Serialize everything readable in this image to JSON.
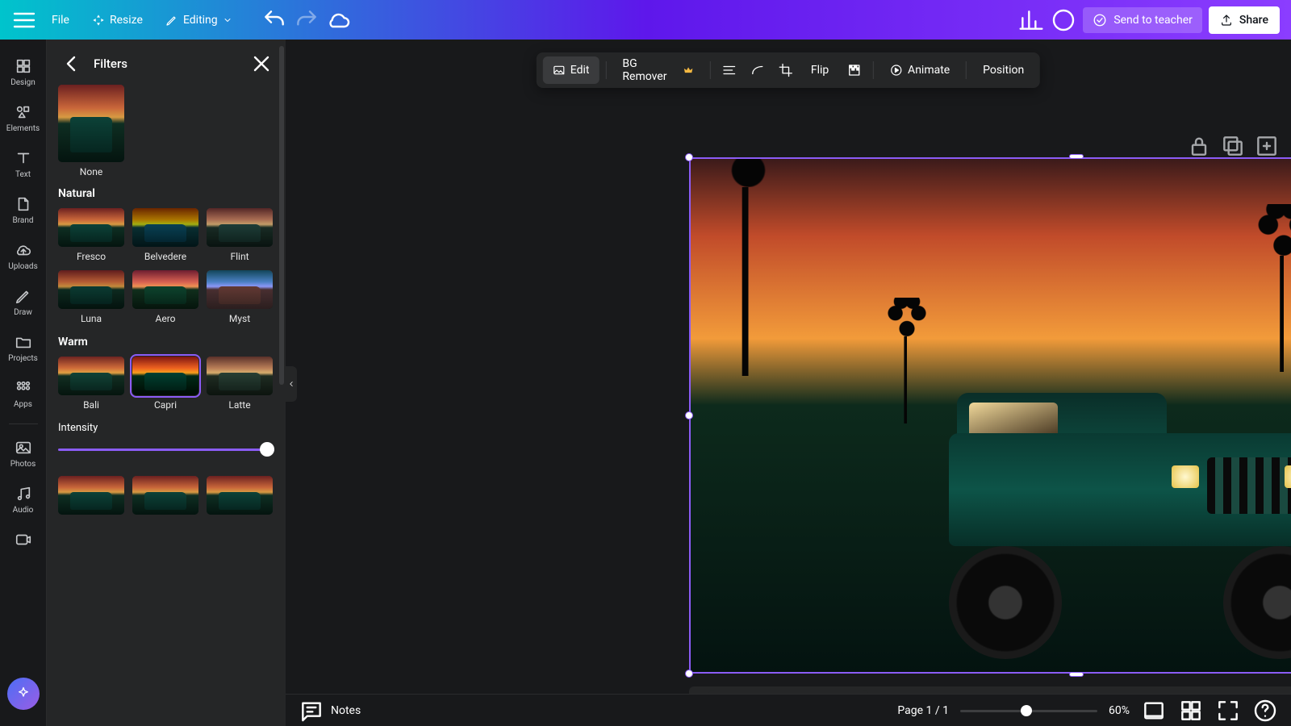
{
  "topbar": {
    "file": "File",
    "resize": "Resize",
    "editing": "Editing",
    "send_teacher": "Send to teacher",
    "share": "Share"
  },
  "rail": {
    "design": "Design",
    "elements": "Elements",
    "text": "Text",
    "brand": "Brand",
    "uploads": "Uploads",
    "draw": "Draw",
    "projects": "Projects",
    "apps": "Apps",
    "photos": "Photos",
    "audio": "Audio"
  },
  "panel": {
    "title": "Filters",
    "none": "None",
    "sections": {
      "natural": "Natural",
      "warm": "Warm"
    },
    "natural": [
      "Fresco",
      "Belvedere",
      "Flint",
      "Luna",
      "Aero",
      "Myst"
    ],
    "warm": [
      "Bali",
      "Capri",
      "Latte"
    ],
    "selected": "Capri",
    "intensity_label": "Intensity"
  },
  "ctx": {
    "edit": "Edit",
    "bg_remover": "BG Remover",
    "flip": "Flip",
    "animate": "Animate",
    "position": "Position"
  },
  "bottom": {
    "notes": "Notes",
    "page_indicator": "Page 1 / 1",
    "zoom": "60%"
  }
}
